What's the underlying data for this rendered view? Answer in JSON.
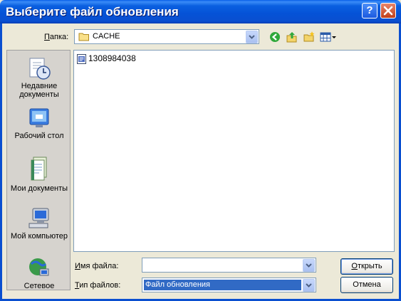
{
  "window": {
    "title": "Выберите файл обновления"
  },
  "lookin": {
    "label_u": "П",
    "label_rest": "апка:",
    "value": "CACHE"
  },
  "toolbar": {
    "icons": [
      "back-icon",
      "up-folder-icon",
      "new-folder-icon",
      "view-menu-icon"
    ]
  },
  "places": [
    {
      "label": "Недавние документы",
      "icon": "recent-documents-icon"
    },
    {
      "label": "Рабочий стол",
      "icon": "desktop-icon"
    },
    {
      "label": "Мои документы",
      "icon": "my-documents-icon"
    },
    {
      "label": "Мой компьютер",
      "icon": "my-computer-icon"
    },
    {
      "label": "Сетевое",
      "icon": "network-icon"
    }
  ],
  "files": [
    {
      "name": "1308984038",
      "icon": "file-icon"
    }
  ],
  "filename": {
    "label_u": "И",
    "label_rest": "мя файла:",
    "value": ""
  },
  "filetype": {
    "label_u": "Т",
    "label_rest": "ип файлов:",
    "value": "Файл обновления"
  },
  "buttons": {
    "open_u": "О",
    "open_rest": "ткрыть",
    "cancel": "Отмена"
  },
  "colors": {
    "titlebar": "#0a5fe0",
    "dialog_bg": "#ece9d8",
    "selection": "#316ac5"
  }
}
